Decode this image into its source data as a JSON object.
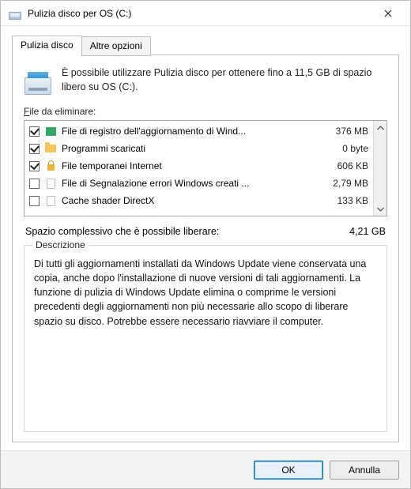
{
  "titlebar": {
    "title": "Pulizia disco per OS (C:)"
  },
  "tabs": {
    "active": "Pulizia disco",
    "other": "Altre opzioni"
  },
  "intro": {
    "text": "È possibile utilizzare Pulizia disco per ottenere fino a 11,5 GB di spazio libero su OS (C:)."
  },
  "files": {
    "label_pre": "F",
    "label_rest": "ile da eliminare:",
    "items": [
      {
        "checked": true,
        "icon": "green",
        "name": "File di registro dell'aggiornamento di Wind...",
        "size": "376 MB"
      },
      {
        "checked": true,
        "icon": "folder",
        "name": "Programmi scaricati",
        "size": "0 byte"
      },
      {
        "checked": true,
        "icon": "lock",
        "name": "File temporanei Internet",
        "size": "606 KB"
      },
      {
        "checked": false,
        "icon": "file",
        "name": "File di Segnalazione errori Windows creati ...",
        "size": "2,79 MB"
      },
      {
        "checked": false,
        "icon": "file",
        "name": "Cache shader DirectX",
        "size": "133 KB"
      }
    ]
  },
  "total": {
    "label": "Spazio complessivo che è possibile liberare:",
    "value": "4,21 GB"
  },
  "description": {
    "legend": "Descrizione",
    "text": "Di tutti gli aggiornamenti installati da Windows Update viene conservata una copia, anche dopo l'installazione di nuove versioni di tali aggiornamenti. La funzione di pulizia di Windows Update elimina o comprime le versioni precedenti degli aggiornamenti non più necessarie allo scopo di liberare spazio su disco. Potrebbe essere necessario riavviare il computer."
  },
  "buttons": {
    "ok": "OK",
    "cancel": "Annulla"
  }
}
